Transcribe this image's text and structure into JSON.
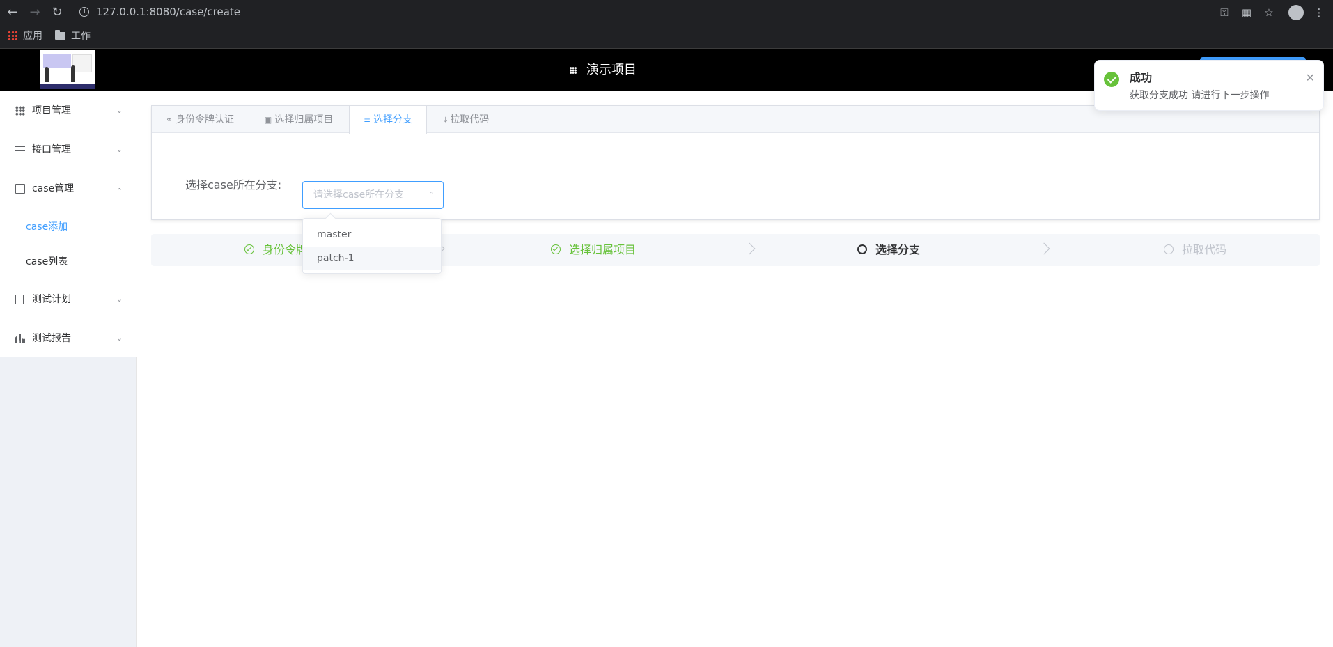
{
  "browser": {
    "url": "127.0.0.1:8080/case/create",
    "bookmarks": [
      {
        "label": "应用",
        "icon": "apps-grid-icon"
      },
      {
        "label": "工作",
        "icon": "folder-icon"
      }
    ]
  },
  "header": {
    "title": "演示项目",
    "icon": "grid-icon"
  },
  "sidebar": {
    "items": [
      {
        "label": "项目管理",
        "icon": "grid-icon",
        "expanded": false
      },
      {
        "label": "接口管理",
        "icon": "list-icon",
        "expanded": false
      },
      {
        "label": "case管理",
        "icon": "edit-icon",
        "expanded": true,
        "children": [
          {
            "label": "case添加",
            "active": true
          },
          {
            "label": "case列表",
            "active": false
          }
        ]
      },
      {
        "label": "测试计划",
        "icon": "document-icon",
        "expanded": false
      },
      {
        "label": "测试报告",
        "icon": "bar-chart-icon",
        "expanded": false
      }
    ]
  },
  "tabs": [
    {
      "label": "身份令牌认证",
      "icon": "key-icon",
      "active": false
    },
    {
      "label": "选择归属项目",
      "icon": "monitor-icon",
      "active": false
    },
    {
      "label": "选择分支",
      "icon": "filter-icon",
      "active": true
    },
    {
      "label": "拉取代码",
      "icon": "download-icon",
      "active": false
    }
  ],
  "form": {
    "label": "选择case所在分支:",
    "placeholder": "请选择case所在分支",
    "options": [
      "master",
      "patch-1"
    ],
    "hovered_option": "patch-1"
  },
  "steps": [
    {
      "label": "身份令牌认证",
      "status": "success"
    },
    {
      "label": "选择归属项目",
      "status": "success"
    },
    {
      "label": "选择分支",
      "status": "process"
    },
    {
      "label": "拉取代码",
      "status": "wait"
    }
  ],
  "notification": {
    "title": "成功",
    "message": "获取分支成功 请进行下一步操作",
    "type": "success",
    "color": "#67c23a"
  },
  "colors": {
    "primary": "#409eff",
    "success": "#67c23a",
    "header_bg": "#000000",
    "sidebar_bg": "#eef1f6"
  }
}
